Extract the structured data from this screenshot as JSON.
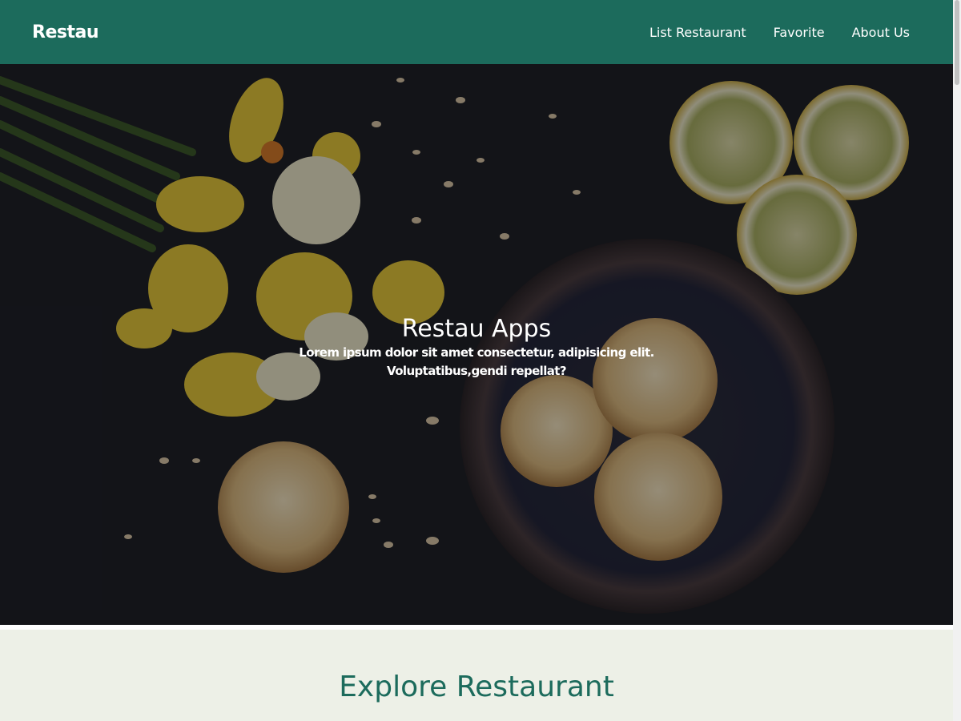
{
  "header": {
    "brand": "Restau",
    "nav": [
      {
        "label": "List Restaurant"
      },
      {
        "label": "Favorite"
      },
      {
        "label": "About Us"
      }
    ]
  },
  "hero": {
    "title": "Restau Apps",
    "subtitle": "Lorem ipsum dolor sit amet consectetur, adipisicing elit. Voluptatibus,gendi repellat?",
    "image": "hero-food-photo"
  },
  "explore": {
    "title": "Explore Restaurant"
  },
  "colors": {
    "primary": "#1c6b5c",
    "section_background": "#edf0e7",
    "hero_background": "#1d1e24"
  }
}
